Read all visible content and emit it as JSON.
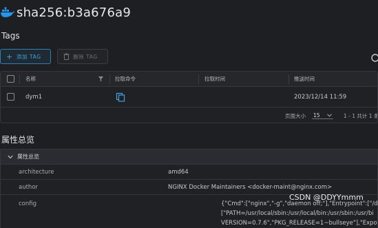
{
  "header": {
    "title": "sha256:b3a676a9",
    "icon": "docker-whale-icon"
  },
  "tags": {
    "heading": "Tags",
    "add_label": "添加 TAG",
    "delete_label": "删除 TAG",
    "columns": [
      "名称",
      "拉取命令",
      "拉取时间",
      "推送时间"
    ],
    "rows": [
      {
        "name": "dym1",
        "pull_time": "",
        "push_time": "2023/12/14 11:59"
      }
    ],
    "pagination": {
      "page_size_label": "页面大小",
      "page_size": "15",
      "summary": "1 - 1 共计 1 条记"
    }
  },
  "properties": {
    "heading": "属性总览",
    "panel_title": "属性总览",
    "rows": [
      {
        "key": "architecture",
        "value": "amd64"
      },
      {
        "key": "author",
        "value": "NGINX Docker Maintainers <docker-maint@nginx.com>"
      }
    ],
    "config_key": "config",
    "config_lines": [
      "{\"Cmd\":[\"nginx\",\"-g\",\"daemon off;\"],\"Entrypoint\":[\"/dc",
      "[\"PATH=/usr/local/sbin:/usr/local/bin:/usr/sbin:/usr/bi",
      "VERSION=0.7.6\",\"PKG_RELEASE=1~bullseye\"],\"Expos"
    ]
  },
  "watermark": "CSDN @DDYYmmm",
  "colors": {
    "background": "#1e1f22",
    "accent": "#3fa1e0",
    "border": "#35373c"
  }
}
